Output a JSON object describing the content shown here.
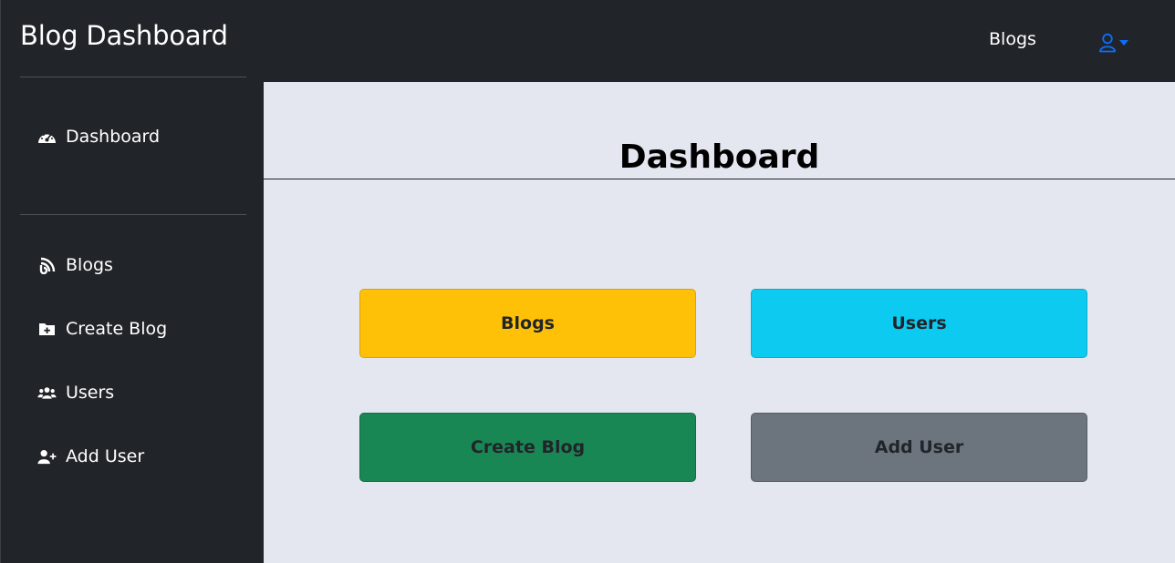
{
  "app": {
    "brand": "Blog Dashboard"
  },
  "sidebar": {
    "items": [
      {
        "label": "Dashboard",
        "icon": "gauge-icon"
      },
      {
        "label": "Blogs",
        "icon": "rss-icon"
      },
      {
        "label": "Create Blog",
        "icon": "folder-plus-icon"
      },
      {
        "label": "Users",
        "icon": "users-icon"
      },
      {
        "label": "Add User",
        "icon": "user-plus-icon"
      }
    ]
  },
  "topnav": {
    "blogs_link": "Blogs",
    "user_icon": "user-icon",
    "dropdown_icon": "caret-down-icon",
    "accent": "#0d6efd"
  },
  "main": {
    "title": "Dashboard",
    "tiles": [
      {
        "label": "Blogs",
        "color": "#ffc107",
        "border": "#d9a406"
      },
      {
        "label": "Users",
        "color": "#0dcaf0",
        "border": "#0bacca"
      },
      {
        "label": "Create Blog",
        "color": "#198754",
        "border": "#146c43"
      },
      {
        "label": "Add User",
        "color": "#6c757d",
        "border": "#565e64"
      }
    ]
  },
  "colors": {
    "dark": "#212529",
    "content_bg": "#e4e6f0"
  }
}
